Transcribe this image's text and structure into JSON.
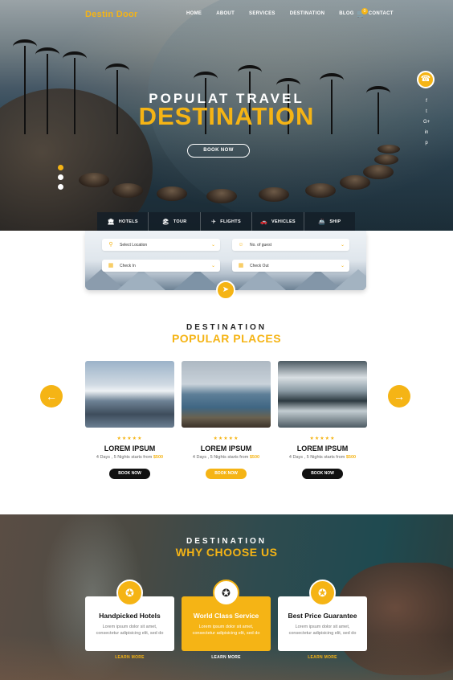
{
  "brand": "Destin Door",
  "nav": [
    "HOME",
    "ABOUT",
    "SERVICES",
    "DESTINATION",
    "BLOG",
    "CONTACT"
  ],
  "cart_count": "0",
  "hero": {
    "subtitle": "POPULAT TRAVEL",
    "title": "DESTINATION",
    "button": "BOOK NOW"
  },
  "social_icons": [
    "f",
    "t",
    "G+",
    "in",
    "p"
  ],
  "tabs": [
    {
      "label": "HOTELS",
      "icon": "🏛"
    },
    {
      "label": "TOUR",
      "icon": "🏖"
    },
    {
      "label": "FLIGHTS",
      "icon": "✈"
    },
    {
      "label": "VEHICLES",
      "icon": "🚗"
    },
    {
      "label": "SHIP",
      "icon": "🚢"
    }
  ],
  "search": {
    "location": "Select Location",
    "guests": "No. of guest",
    "check_in": "Check In",
    "check_out": "Check Out"
  },
  "popular": {
    "subtitle": "DESTINATION",
    "title": "POPULAR PLACES",
    "cards": [
      {
        "name": "LOREM IPSUM",
        "meta": "4 Days , 5 Nights starts from",
        "price": "$500",
        "button": "BOOK NOW",
        "stars": "★★★★★"
      },
      {
        "name": "LOREM IPSUM",
        "meta": "4 Days , 5 Nights starts from",
        "price": "$500",
        "button": "BOOK NOW",
        "stars": "★★★★★"
      },
      {
        "name": "LOREM IPSUM",
        "meta": "4 Days , 5 Nights starts from",
        "price": "$500",
        "button": "BOOK NOW",
        "stars": "★★★★★"
      }
    ]
  },
  "why": {
    "subtitle": "DESTINATION",
    "title": "WHY CHOOSE US",
    "features": [
      {
        "title": "Handpicked Hotels",
        "text": "Lorem ipsum dolor sit amet, consectetur adipisicing elit, sed do",
        "link": "LEARN MORE"
      },
      {
        "title": "World Class Service",
        "text": "Lorem ipsum dolor sit amet, consectetur adipisicing elit, sed do",
        "link": "LEARN MORE"
      },
      {
        "title": "Best Price Guarantee",
        "text": "Lorem ipsum dolor sit amet, consectetur adipisicing elit, sed do",
        "link": "LEARN MORE"
      }
    ]
  },
  "colors": {
    "accent": "#f5b415",
    "dark": "#111111"
  }
}
